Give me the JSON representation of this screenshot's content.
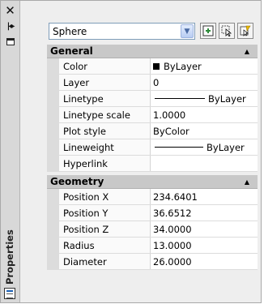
{
  "palette": {
    "title": "Properties",
    "selector": {
      "value": "Sphere"
    },
    "buttons": {
      "toggle_pickadd": "toggle-pickadd",
      "select_objects": "select-objects",
      "quick_select": "quick-select"
    }
  },
  "sections": [
    {
      "title": "General",
      "rows": [
        {
          "label": "Color",
          "value": "ByLayer"
        },
        {
          "label": "Layer",
          "value": "0"
        },
        {
          "label": "Linetype",
          "value": "ByLayer"
        },
        {
          "label": "Linetype scale",
          "value": "1.0000"
        },
        {
          "label": "Plot style",
          "value": "ByColor"
        },
        {
          "label": "Lineweight",
          "value": "ByLayer"
        },
        {
          "label": "Hyperlink",
          "value": ""
        }
      ]
    },
    {
      "title": "Geometry",
      "rows": [
        {
          "label": "Position X",
          "value": "234.6401"
        },
        {
          "label": "Position Y",
          "value": "36.6512"
        },
        {
          "label": "Position Z",
          "value": "34.0000"
        },
        {
          "label": "Radius",
          "value": "13.0000"
        },
        {
          "label": "Diameter",
          "value": "26.0000"
        }
      ]
    }
  ],
  "colors": {
    "header_bg": "#c8c8c8",
    "strip_bg": "#d8d8d8",
    "color_swatch": "#000000"
  }
}
